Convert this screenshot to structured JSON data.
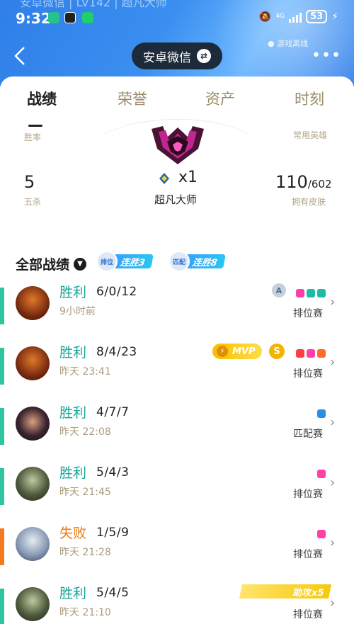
{
  "status_bar": {
    "time": "9:32",
    "network": "4G",
    "battery": "53"
  },
  "header": {
    "ghost_text": "安卓微信 | LV142 | 超凡大师",
    "account_label": "安卓微信",
    "status_text": "游戏离线"
  },
  "tabs": [
    {
      "label": "战绩"
    },
    {
      "label": "荣誉"
    },
    {
      "label": "资产"
    },
    {
      "label": "时刻"
    }
  ],
  "stats": {
    "win_rate_label": "胜率",
    "heroes_label": "常用英雄",
    "pentakill_value": "5",
    "pentakill_label": "五杀",
    "rank_count": "x1",
    "rank_name": "超凡大师",
    "skins_owned": "110",
    "skins_total": "/602",
    "skins_label": "拥有皮肤"
  },
  "records_header": {
    "title": "全部战绩",
    "streak_ranked_tag": "排位",
    "streak_ranked": "连胜3",
    "streak_match_tag": "匹配",
    "streak_match": "连胜8"
  },
  "records": [
    {
      "result": "胜利",
      "kda": "6/0/12",
      "time": "9小时前",
      "mode": "排位赛",
      "tier": "A"
    },
    {
      "result": "胜利",
      "kda": "8/4/23",
      "time": "昨天 23:41",
      "mode": "排位赛",
      "mvp": "MVP",
      "coin": "S"
    },
    {
      "result": "胜利",
      "kda": "4/7/7",
      "time": "昨天 22:08",
      "mode": "匹配赛"
    },
    {
      "result": "胜利",
      "kda": "5/4/3",
      "time": "昨天 21:45",
      "mode": "排位赛"
    },
    {
      "result": "失败",
      "kda": "1/5/9",
      "time": "昨天 21:28",
      "mode": "排位赛"
    },
    {
      "result": "胜利",
      "kda": "5/4/5",
      "time": "昨天 21:10",
      "mode": "排位赛",
      "assist": "助攻x5"
    }
  ],
  "colors": {
    "win": "#17a597",
    "lose": "#ef7a12",
    "win_bar": "#2ec4a0",
    "lose_bar": "#f47a1f",
    "header_blue": "#3a8ff0"
  },
  "icons": {
    "back": "chevron-left-icon",
    "swap": "swap-icon",
    "more": "more-dots-icon",
    "dropdown": "chevron-down-icon",
    "row_arrow": "chevron-right-icon"
  }
}
